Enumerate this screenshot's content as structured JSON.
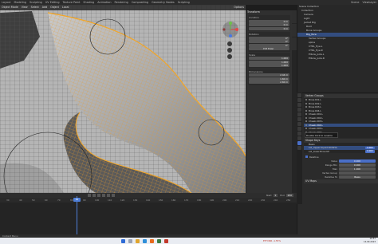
{
  "topbar": {
    "tabs": [
      "Layout",
      "Modeling",
      "Sculpting",
      "UV Editing",
      "Texture Paint",
      "Shading",
      "Animation",
      "Rendering",
      "Compositing",
      "Geometry Nodes",
      "Scripting"
    ],
    "active_tab": "Layout",
    "scene_label": "Scene",
    "view_layer_label": "ViewLayer"
  },
  "viewport": {
    "header_items": [
      "Object Mode",
      "View",
      "Select",
      "Add",
      "Object",
      "Local"
    ],
    "options_label": "Options"
  },
  "npanel": {
    "title": "Transform",
    "location_label": "Location",
    "location": [
      "0 m",
      "0 m",
      "0 m"
    ],
    "rotation_label": "Rotation",
    "rotation": [
      "0°",
      "0°",
      "0°"
    ],
    "mode": "XYZ Euler",
    "scale_label": "Scale",
    "scale": [
      "1.000",
      "1.000",
      "1.000"
    ],
    "dimensions_label": "Dimensions",
    "dimensions": [
      "2.44 m",
      "1.60 m",
      "2.60 m"
    ]
  },
  "outliner": {
    "title": "Scene Collection",
    "rows": [
      {
        "label": "Scene Collection",
        "sel": false
      },
      {
        "label": "Collection",
        "sel": false
      },
      {
        "label": "Camera",
        "sel": false
      },
      {
        "label": "Light",
        "sel": false
      },
      {
        "label": "Jacket Rig",
        "sel": false
      },
      {
        "label": "Root",
        "sel": false
      },
      {
        "label": "Bone Groups",
        "sel": false
      },
      {
        "label": "Rig_face",
        "sel": true
      },
      {
        "label": "Vertex Groups",
        "sel": false
      },
      {
        "label": "spine",
        "sel": false
      },
      {
        "label": "CTRL_Eye.L",
        "sel": false
      },
      {
        "label": "CTRL_Eye.R",
        "sel": false
      },
      {
        "label": "Elbow_pole.L",
        "sel": false
      },
      {
        "label": "Elbow_pole.R",
        "sel": false
      }
    ]
  },
  "props": {
    "vertex_groups_title": "Vertex Groups",
    "vertex_groups": [
      {
        "label": "Brow.001.L",
        "sel": false
      },
      {
        "label": "Brow.002.L",
        "sel": false
      },
      {
        "label": "Brow.003.L",
        "sel": false
      },
      {
        "label": "Brow.004.L",
        "sel": false
      },
      {
        "label": "Cheek.001.L",
        "sel": false
      },
      {
        "label": "Cheek.002.L",
        "sel": false
      },
      {
        "label": "Cheek.003.L",
        "sel": false
      },
      {
        "label": "Cheek.004.L",
        "sel": true
      },
      {
        "label": "Cheek.005.L",
        "sel": false
      },
      {
        "label": "Cheek.006.L",
        "sel": false
      },
      {
        "label": "Cheek.007.L",
        "sel": false
      }
    ],
    "shape_keys_title": "Shape Keys",
    "shape_keys": [
      {
        "label": "Basis",
        "value": ""
      },
      {
        "label": "Lid_Upper.Squint.NOSHA",
        "value": "0.000"
      },
      {
        "label": "Lid_lower.Brow.UP",
        "value": "0.000"
      }
    ],
    "relative_label": "Relative",
    "value_label": "Value",
    "value": "0.000",
    "range_min_label": "Range Min",
    "range_min": "0.000",
    "max_label": "Max",
    "max": "1.000",
    "vertex_group_label": "Vertex Group",
    "relative_to_label": "Relative To",
    "relative_to": "Basis",
    "uv_maps_label": "UV Maps",
    "tooltip": "Double Click to rename"
  },
  "timeline": {
    "ticks": [
      "30",
      "40",
      "50",
      "60",
      "70",
      "80",
      "90",
      "100",
      "110",
      "120",
      "130",
      "140",
      "150",
      "160",
      "170",
      "180",
      "190",
      "200",
      "210",
      "220",
      "230",
      "240",
      "250"
    ],
    "current_frame": "85",
    "start_label": "Start",
    "start": "1",
    "end_label": "End",
    "end": "250"
  },
  "statusbar": {
    "text": "Context Menu"
  },
  "taskbar": {
    "weather": "ETH  INR  -1.55%",
    "time": "10:57",
    "date": "14-09-2023"
  },
  "colors": {
    "accent": "#4a6fc7",
    "selection": "#334d80",
    "wire": "#f5a623",
    "panel": "#2b2b2b"
  }
}
